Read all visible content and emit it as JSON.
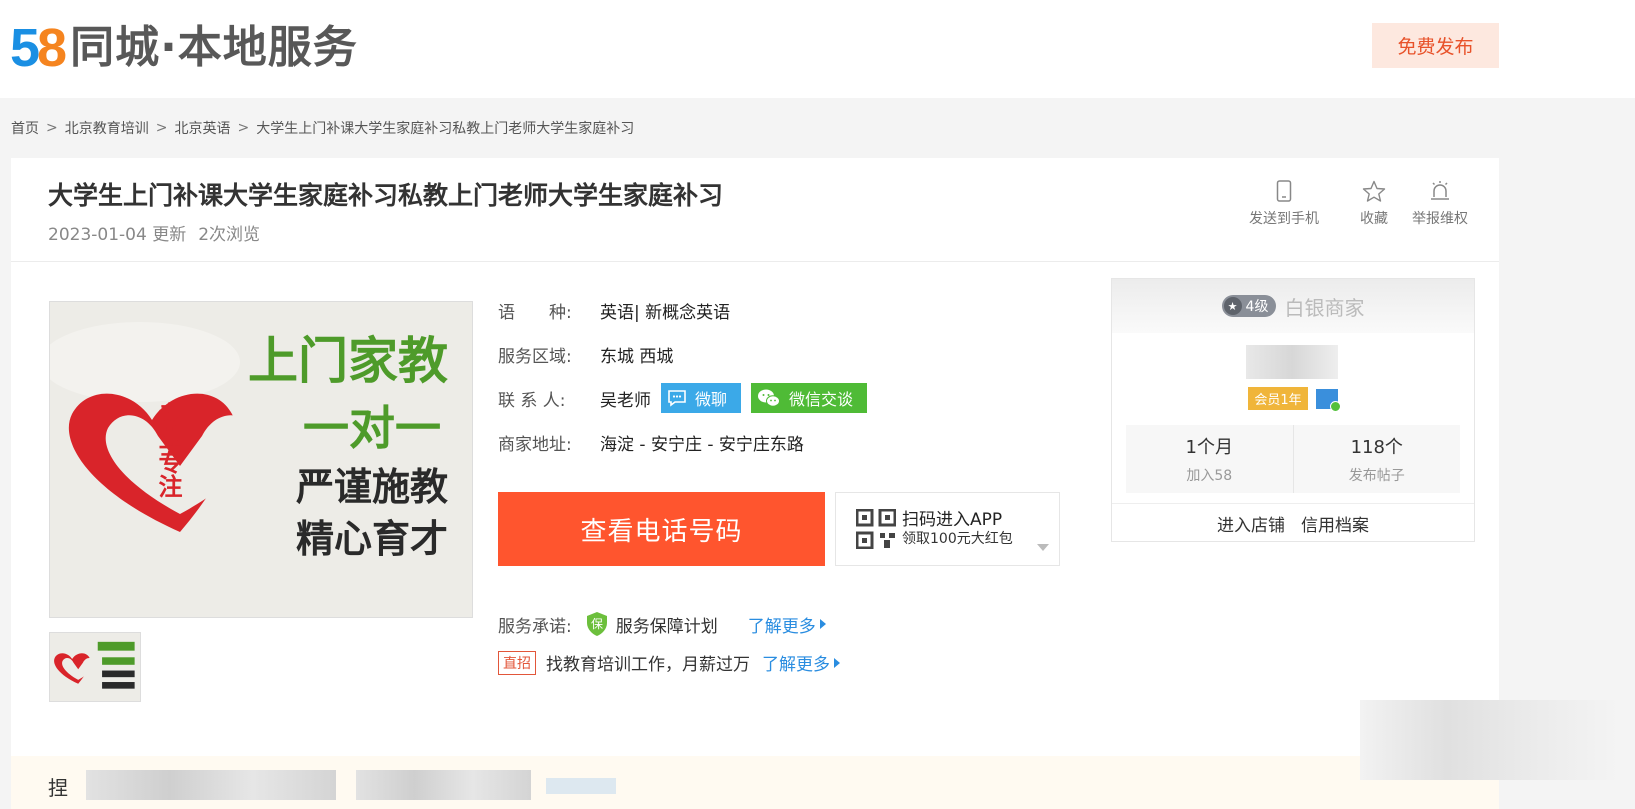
{
  "logo": {
    "digit_five": "5",
    "digit_eight": "8",
    "text": "同城·本地服务"
  },
  "header": {
    "post_button": "免费发布"
  },
  "breadcrumb": [
    "首页",
    "北京教育培训",
    "北京英语",
    "大学生上门补课大学生家庭补习私教上门老师大学生家庭补习"
  ],
  "breadcrumb_separator": ">",
  "post": {
    "title": "大学生上门补课大学生家庭补习私教上门老师大学生家庭补习",
    "updated": "2023-01-04 更新",
    "views": "2次浏览"
  },
  "actions": {
    "send_to_phone": "发送到手机",
    "favorite": "收藏",
    "report": "举报维权"
  },
  "image": {
    "slogan": "上门家教",
    "one_to_one": "一对一",
    "line1": "严谨施教",
    "line2": "精心育才",
    "heart_text": "专业专注"
  },
  "info": {
    "language": {
      "label": "语　　种:",
      "value": "英语| 新概念英语"
    },
    "area": {
      "label": "服务区域:",
      "value": "东城  西城"
    },
    "contact": {
      "label": "联 系 人:",
      "value": "吴老师",
      "chat": "微聊",
      "wechat": "微信交谈"
    },
    "address": {
      "label": "商家地址:",
      "value": "海淀 -  安宁庄  - 安宁庄东路"
    }
  },
  "call_button": "查看电话号码",
  "app": {
    "line1": "扫码进入APP",
    "line2": "领取100元大红包"
  },
  "promise": {
    "label": "服务承诺:",
    "icon_char": "保",
    "text": "服务保障计划",
    "more": "了解更多"
  },
  "job": {
    "tag": "直招",
    "text": "找教育培训工作，月薪过万",
    "more": "了解更多"
  },
  "seller": {
    "level": "4级",
    "level_name": "白银商家",
    "member": "会员1年",
    "joined_value": "1个月",
    "joined_label": "加入58",
    "posts_value": "118个",
    "posts_label": "发布帖子",
    "shop": "进入店铺",
    "credit": "信用档案"
  },
  "bottom": {
    "title_char": "捏"
  },
  "colors": {
    "accent": "#ff552e",
    "link": "#2a8de0",
    "chat": "#3ba9e8",
    "wechat": "#4fbb36",
    "member": "#f0b53a"
  }
}
